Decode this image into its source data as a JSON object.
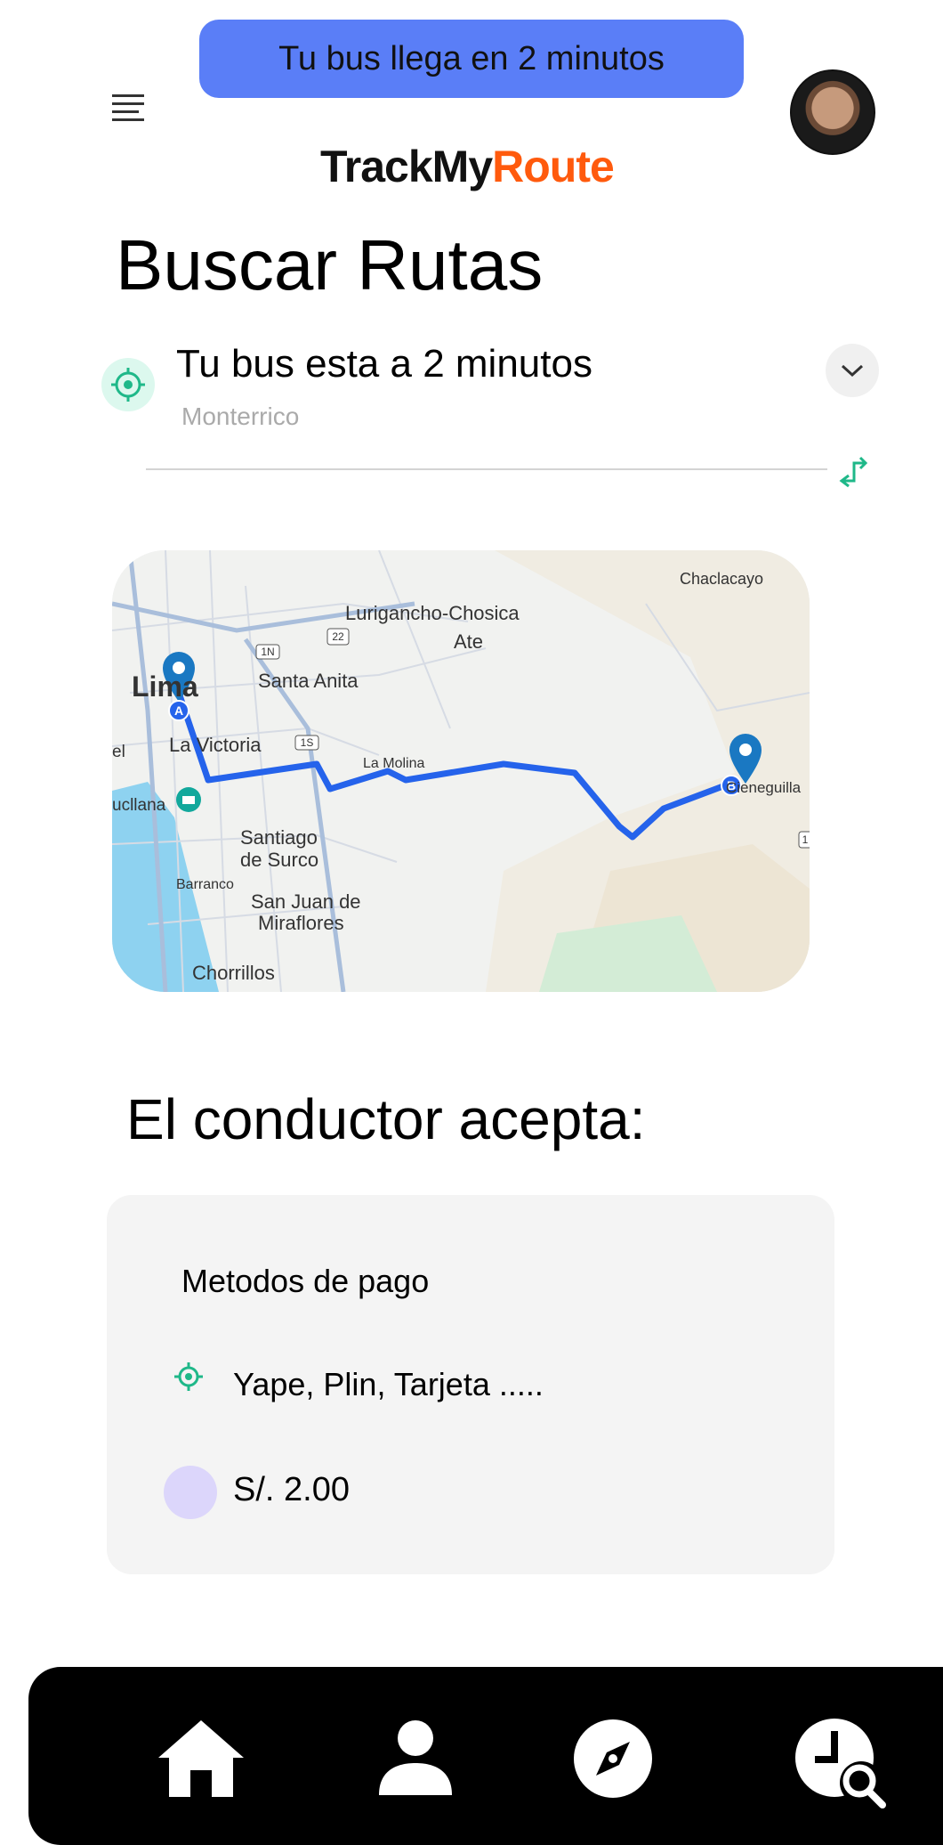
{
  "banner": {
    "text": "Tu bus llega en 2 minutos"
  },
  "header": {
    "menu_icon": "menu-icon",
    "avatar": "avatar",
    "logo_part1": "TrackMy",
    "logo_part2": "Route",
    "logo_color_part1": "#111111",
    "logo_color_part2": "#ff5a0d"
  },
  "page": {
    "title": "Buscar Rutas"
  },
  "route": {
    "title": "Tu bus esta a 2 minutos",
    "subtitle": "Monterrico",
    "icon": "target-icon",
    "expand_icon": "chevron-down-icon",
    "swap_icon": "swap-route-icon"
  },
  "map": {
    "labels": {
      "chaclacayo": "Chaclacayo",
      "lurigancho": "Lurigancho-Chosica",
      "ate": "Ate",
      "lima": "Lima",
      "santa_anita": "Santa Anita",
      "la_victoria": "La Victoria",
      "la_molina": "La Molina",
      "cieneguilla": "Cieneguilla",
      "lucllana": "ucllana",
      "santiago": "Santiago",
      "de_surco": "de Surco",
      "barranco": "Barranco",
      "san_juan": "San Juan de",
      "miraflores": "Miraflores",
      "chorrillos": "Chorrillos",
      "el": "el"
    },
    "roads": {
      "r1n": "1N",
      "r22": "22",
      "r1s": "1S",
      "r1": "1"
    },
    "markers": {
      "start": "A",
      "end": "B"
    },
    "route_color": "#2563eb",
    "marker_color": "#1a78c2"
  },
  "payment": {
    "section_title": "El conductor acepta:",
    "card_title": "Metodos de pago",
    "methods_text": "Yape, Plin, Tarjeta .....",
    "price": "S/. 2.00",
    "accent_color": "#1fb889"
  },
  "nav": {
    "home_icon": "home-icon",
    "profile_icon": "profile-icon",
    "explore_icon": "compass-icon",
    "history_icon": "history-search-icon"
  }
}
